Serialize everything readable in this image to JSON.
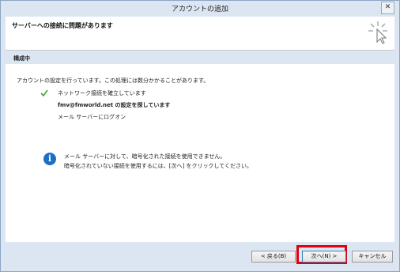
{
  "window": {
    "title": "アカウントの追加",
    "close_label": "✕"
  },
  "header": {
    "heading": "サーバーへの接続に問題があります"
  },
  "section": {
    "title": "構成中"
  },
  "progress": {
    "intro": "アカウントの設定を行っています。この処理には数分かかることがあります。",
    "steps": [
      {
        "label": "ネットワーク接続を確立しています",
        "status": "done"
      },
      {
        "label": "fmv@fmworld.net の設定を探しています",
        "status": "active"
      },
      {
        "label": "メール サーバーにログオン",
        "status": "pending"
      }
    ]
  },
  "info": {
    "icon": "info-icon",
    "line1": "メール サーバーに対して、暗号化された接続を使用できません。",
    "line2": "暗号化されていない接続を使用するには、[次へ] をクリックしてください。"
  },
  "footer": {
    "back_label": "< 戻る(B)",
    "next_label": "次へ(N) >",
    "cancel_label": "キャンセル"
  },
  "colors": {
    "chrome": "#dbe6f2",
    "check": "#3aa832",
    "info": "#1d6fc6",
    "highlight": "#e00010"
  }
}
